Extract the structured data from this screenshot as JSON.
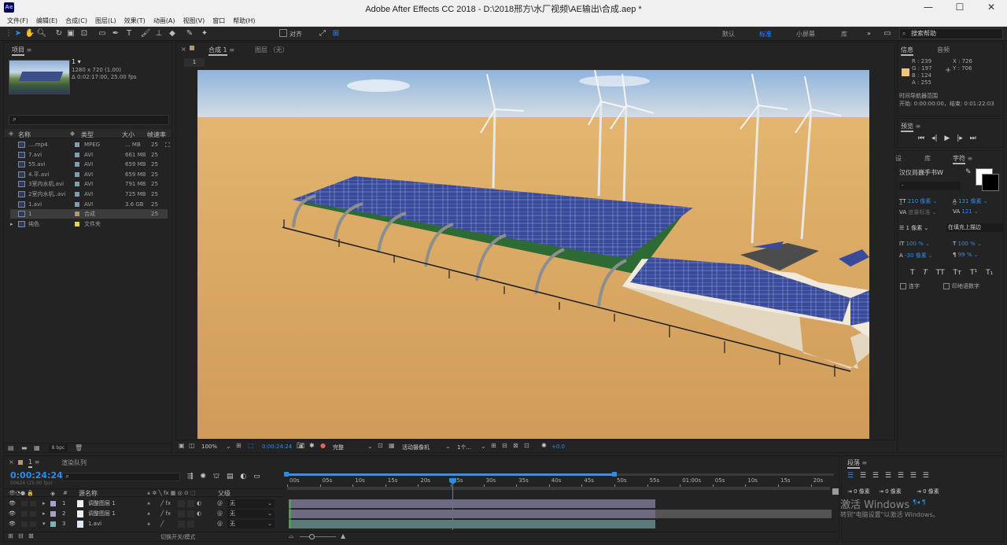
{
  "title": "Adobe After Effects CC 2018 - D:\\2018邢方\\水厂视频\\AE输出\\合成.aep *",
  "app_logo": "Ae",
  "menu": [
    "文件(F)",
    "编辑(E)",
    "合成(C)",
    "图层(L)",
    "效果(T)",
    "动画(A)",
    "视图(V)",
    "窗口",
    "帮助(H)"
  ],
  "toolbar": {
    "align_label": "对齐",
    "workspaces": [
      "默认",
      "标准",
      "小屏幕",
      "库"
    ],
    "active_ws": "标准",
    "search_placeholder": "搜索帮助"
  },
  "project": {
    "tab": "项目",
    "comp_name": "1 ▾",
    "comp_info": "1280 x 720 (1.00)",
    "comp_duration": "Δ 0:02:17:00, 25.00 fps",
    "search_icon": "search-icon",
    "columns": [
      "名称",
      "类型",
      "大小",
      "帧速率"
    ],
    "items": [
      {
        "name": "....mp4",
        "type": "MPEG",
        "size": "... MB",
        "fps": "25",
        "color": "#7f9fb0"
      },
      {
        "name": "7.avi",
        "type": "AVI",
        "size": "661 MB",
        "fps": "25",
        "color": "#7f9fb0"
      },
      {
        "name": "55.avi",
        "type": "AVI",
        "size": "659 MB",
        "fps": "25",
        "color": "#7f9fb0"
      },
      {
        "name": "4.平.avi",
        "type": "AVI",
        "size": "659 MB",
        "fps": "25",
        "color": "#7f9fb0"
      },
      {
        "name": "3室内水机.avi",
        "type": "AVI",
        "size": "791 MB",
        "fps": "25",
        "color": "#7f9fb0"
      },
      {
        "name": "2室内水机..avi",
        "type": "AVI",
        "size": "725 MB",
        "fps": "25",
        "color": "#7f9fb0"
      },
      {
        "name": "1.avi",
        "type": "AVI",
        "size": "3.6 GB",
        "fps": "25",
        "color": "#7f9fb0"
      },
      {
        "name": "1",
        "type": "合成",
        "size": "",
        "fps": "25",
        "color": "#b29776"
      },
      {
        "name": "纯色",
        "type": "文件夹",
        "size": "",
        "fps": "",
        "color": "#e8d24a"
      }
    ],
    "bpc": "8 bpc"
  },
  "comp": {
    "tab": "合成 1",
    "layer_tab": "图层 （无）",
    "sub_tab": "1",
    "zoom": "100%",
    "timecode": "0:00:24:24",
    "quality": "完整",
    "camera": "活动摄像机",
    "views": "1个...",
    "exposure": "+0.0"
  },
  "info": {
    "tabs": [
      "信息",
      "音频"
    ],
    "r": "R : 239",
    "g": "G : 197",
    "b": "B : 124",
    "a": "A : 255",
    "x": "X : 726",
    "y": "Y : 706",
    "swatch": "#efc57c",
    "nav_title": "时间导航器范围",
    "nav_start": "开始: 0:00:00:00，结束: 0:01:22:03"
  },
  "preview": {
    "title": "预览"
  },
  "character": {
    "tabs": [
      "设",
      "库",
      "字符"
    ],
    "font": "汉仪尚巍手书W",
    "style": "-",
    "size": "210 像素",
    "leading": "131 像素",
    "kern": "度量标准",
    "tracking": "121",
    "stroke": "1 像素",
    "stroke_mode": "在填充上描边",
    "vscale": "100 %",
    "hscale": "100 %",
    "baseline": "-30 像素",
    "tsume": "99 %",
    "styles": [
      "T",
      "T",
      "TT",
      "Tт",
      "T¹",
      "T₁"
    ],
    "ligature": "连字",
    "hindi": "印地语数字"
  },
  "paragraph": {
    "title": "段落",
    "indent1": "0 像素",
    "indent2": "0 像素",
    "space": "0 像素"
  },
  "activate": {
    "line1": "激活 Windows",
    "line2": "转到\"电脑设置\"以激活 Windows。"
  },
  "timeline": {
    "tab": "1",
    "render_tab": "渲染队列",
    "timecode": "0:00:24:24",
    "frame": "00624 (25.00 fps)",
    "ruler": [
      "00s",
      "05s",
      "10s",
      "15s",
      "20s",
      "25s",
      "30s",
      "35s",
      "40s",
      "45s",
      "50s",
      "55s",
      "01:00s",
      "05s",
      "10s",
      "15s",
      "20s"
    ],
    "col_source": "源名称",
    "col_parent": "父级",
    "layers": [
      {
        "num": "1",
        "name": "调整图层 1",
        "parent": "无",
        "color": "#a8a0c8"
      },
      {
        "num": "2",
        "name": "调整图层 1",
        "parent": "无",
        "color": "#a8a0c8"
      },
      {
        "num": "3",
        "name": "1.avi",
        "parent": "无",
        "color": "#7fb3b0"
      }
    ],
    "footer": "切换开关/模式"
  }
}
